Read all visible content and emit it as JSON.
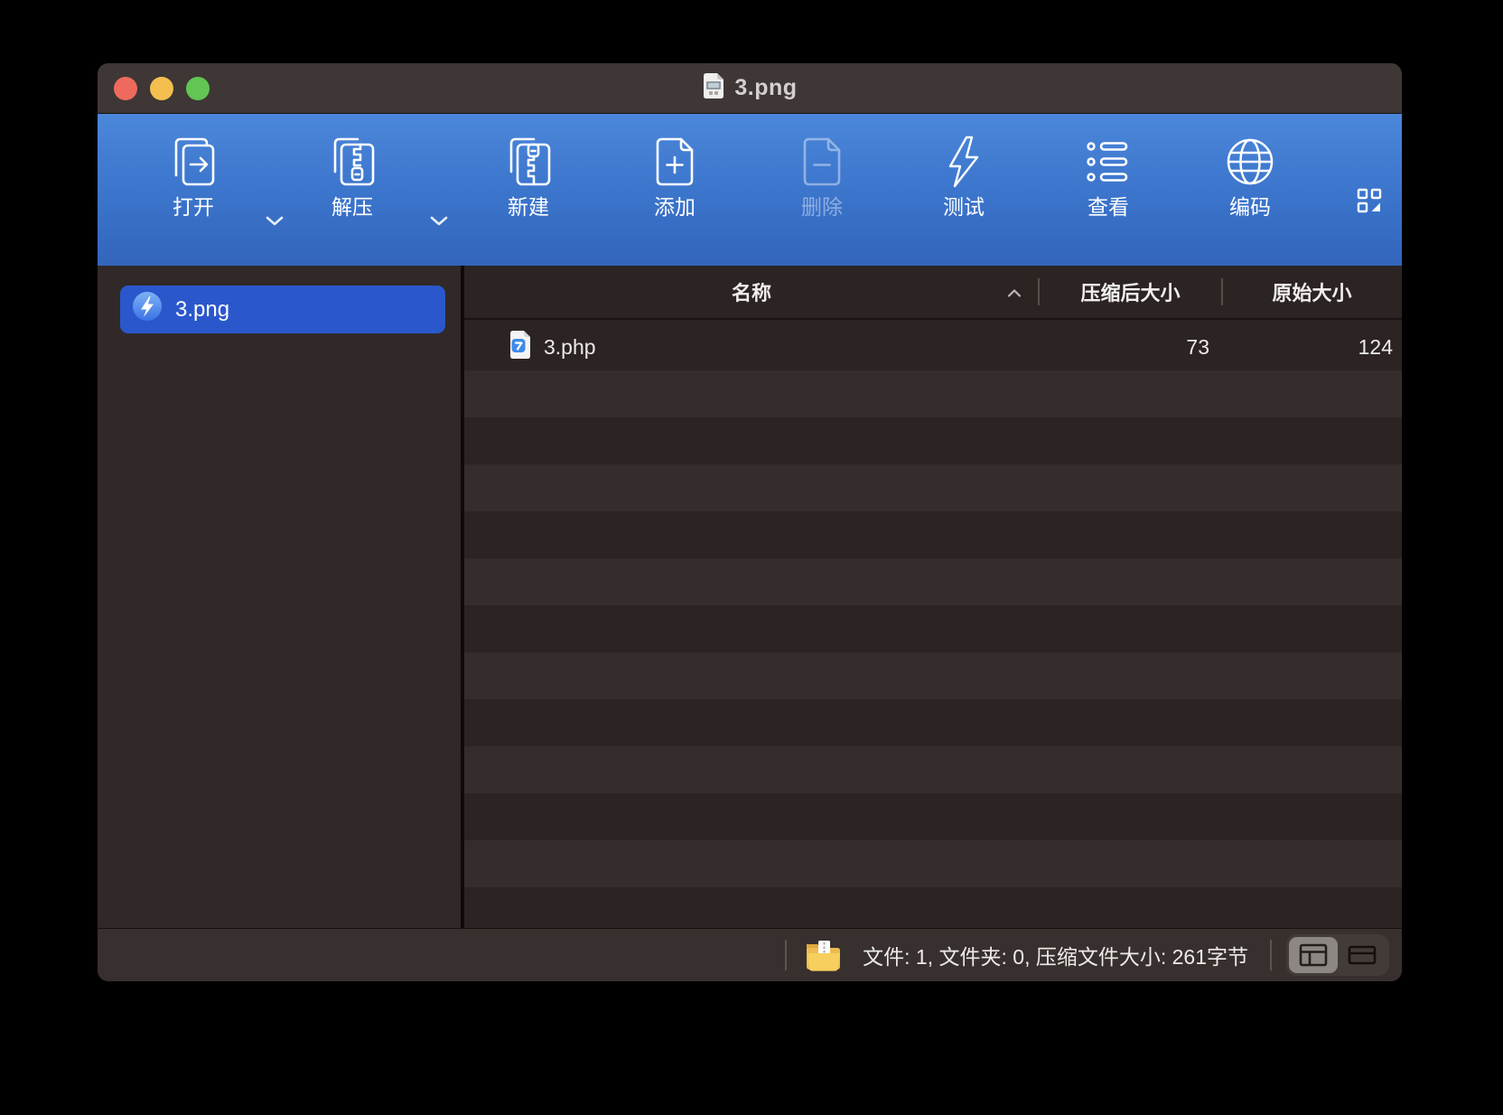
{
  "window": {
    "title": "3.png",
    "traffic_light_colors": [
      "#ee6a5f",
      "#f5bf4f",
      "#62c554"
    ]
  },
  "toolbar": {
    "items": [
      {
        "label": "打开",
        "icon": "open-document-icon",
        "dropdown": true,
        "disabled": false
      },
      {
        "label": "解压",
        "icon": "extract-archive-icon",
        "dropdown": true,
        "disabled": false
      },
      {
        "label": "新建",
        "icon": "new-archive-icon",
        "dropdown": false,
        "disabled": false
      },
      {
        "label": "添加",
        "icon": "add-file-icon",
        "dropdown": false,
        "disabled": false
      },
      {
        "label": "删除",
        "icon": "delete-file-icon",
        "dropdown": false,
        "disabled": true
      },
      {
        "label": "测试",
        "icon": "test-lightning-icon",
        "dropdown": false,
        "disabled": false
      },
      {
        "label": "查看",
        "icon": "view-list-icon",
        "dropdown": false,
        "disabled": false
      },
      {
        "label": "编码",
        "icon": "encoding-globe-icon",
        "dropdown": false,
        "disabled": false
      }
    ],
    "style_button_icon": "toolbar-style-icon",
    "colors": {
      "gradient_top": "#4b87da",
      "gradient_bottom": "#3365bc"
    }
  },
  "sidebar": {
    "items": [
      {
        "label": "3.png",
        "icon": "app-bolt-badge-icon",
        "selected": true
      }
    ],
    "selection_color": "#2b57cd"
  },
  "table": {
    "columns": [
      {
        "label": "名称",
        "sort": "ascending",
        "sort_icon": "chevron-up-icon"
      },
      {
        "label": "压缩后大小",
        "sort": null
      },
      {
        "label": "原始大小",
        "sort": null
      }
    ],
    "rows": [
      {
        "name": "3.php",
        "icon": "php-file-icon",
        "compressed": "73",
        "original": "124"
      }
    ]
  },
  "statusbar": {
    "archive_icon": "zip-folder-icon",
    "summary": "文件: 1, 文件夹: 0, 压缩文件大小: 261字节",
    "view_buttons": [
      {
        "icon": "layout-sidebar-table-icon",
        "selected": true
      },
      {
        "icon": "layout-table-only-icon",
        "selected": false
      }
    ]
  },
  "colors": {
    "window_background": "#2b2423",
    "titlebar": "#3e3735",
    "sidebar_background": "#302927",
    "row_stripe_light": "#342d2b",
    "statusbar_background": "#38302e"
  }
}
